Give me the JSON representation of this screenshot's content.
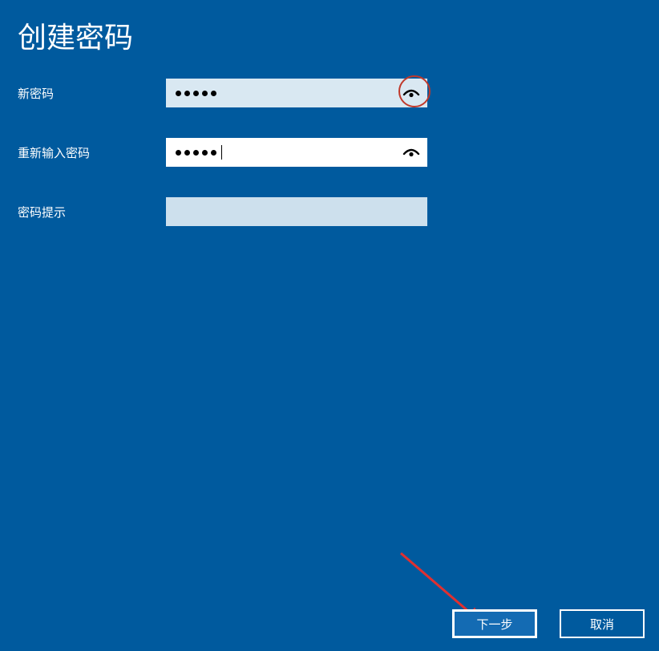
{
  "title": "创建密码",
  "form": {
    "new_password": {
      "label": "新密码",
      "dots": 5
    },
    "confirm_password": {
      "label": "重新输入密码",
      "dots": 5
    },
    "hint": {
      "label": "密码提示",
      "value": ""
    }
  },
  "buttons": {
    "next": "下一步",
    "cancel": "取消"
  }
}
